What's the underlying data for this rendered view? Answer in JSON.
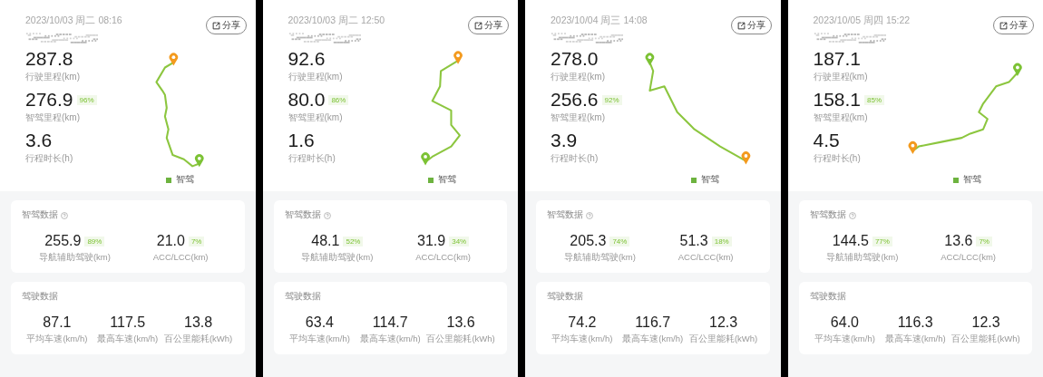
{
  "trips": [
    {
      "date": "2023/10/03 周二 08:16",
      "share": "分享",
      "stats": [
        {
          "value": "287.8",
          "label": "行驶里程(km)"
        },
        {
          "value": "276.9",
          "badge": "96%",
          "label": "智驾里程(km)"
        },
        {
          "value": "3.6",
          "label": "行程时长(h)"
        }
      ],
      "legend": "智驾",
      "smart_card": {
        "title": "智驾数据",
        "items": [
          {
            "value": "255.9",
            "badge": "89%",
            "label": "导航辅助驾驶(km)"
          },
          {
            "value": "21.0",
            "badge": "7%",
            "label": "ACC/LCC(km)"
          }
        ]
      },
      "drive_card": {
        "title": "驾驶数据",
        "items": [
          {
            "value": "87.1",
            "label": "平均车速(km/h)"
          },
          {
            "value": "117.5",
            "label": "最高车速(km/h)"
          },
          {
            "value": "13.8",
            "label": "百公里能耗(kWh)"
          }
        ]
      }
    },
    {
      "date": "2023/10/03 周二 12:50",
      "share": "分享",
      "stats": [
        {
          "value": "92.6",
          "label": "行驶里程(km)"
        },
        {
          "value": "80.0",
          "badge": "86%",
          "label": "智驾里程(km)"
        },
        {
          "value": "1.6",
          "label": "行程时长(h)"
        }
      ],
      "legend": "智驾",
      "smart_card": {
        "title": "智驾数据",
        "items": [
          {
            "value": "48.1",
            "badge": "52%",
            "label": "导航辅助驾驶(km)"
          },
          {
            "value": "31.9",
            "badge": "34%",
            "label": "ACC/LCC(km)"
          }
        ]
      },
      "drive_card": {
        "title": "驾驶数据",
        "items": [
          {
            "value": "63.4",
            "label": "平均车速(km/h)"
          },
          {
            "value": "114.7",
            "label": "最高车速(km/h)"
          },
          {
            "value": "13.6",
            "label": "百公里能耗(kWh)"
          }
        ]
      }
    },
    {
      "date": "2023/10/04 周三 14:08",
      "share": "分享",
      "stats": [
        {
          "value": "278.0",
          "label": "行驶里程(km)"
        },
        {
          "value": "256.6",
          "badge": "92%",
          "label": "智驾里程(km)"
        },
        {
          "value": "3.9",
          "label": "行程时长(h)"
        }
      ],
      "legend": "智驾",
      "smart_card": {
        "title": "智驾数据",
        "items": [
          {
            "value": "205.3",
            "badge": "74%",
            "label": "导航辅助驾驶(km)"
          },
          {
            "value": "51.3",
            "badge": "18%",
            "label": "ACC/LCC(km)"
          }
        ]
      },
      "drive_card": {
        "title": "驾驶数据",
        "items": [
          {
            "value": "74.2",
            "label": "平均车速(km/h)"
          },
          {
            "value": "116.7",
            "label": "最高车速(km/h)"
          },
          {
            "value": "12.3",
            "label": "百公里能耗(kWh)"
          }
        ]
      }
    },
    {
      "date": "2023/10/05 周四 15:22",
      "share": "分享",
      "stats": [
        {
          "value": "187.1",
          "label": "行驶里程(km)"
        },
        {
          "value": "158.1",
          "badge": "85%",
          "label": "智驾里程(km)"
        },
        {
          "value": "4.5",
          "label": "行程时长(h)"
        }
      ],
      "legend": "智驾",
      "smart_card": {
        "title": "智驾数据",
        "items": [
          {
            "value": "144.5",
            "badge": "77%",
            "label": "导航辅助驾驶(km)"
          },
          {
            "value": "13.6",
            "badge": "7%",
            "label": "ACC/LCC(km)"
          }
        ]
      },
      "drive_card": {
        "title": "驾驶数据",
        "items": [
          {
            "value": "64.0",
            "label": "平均车速(km/h)"
          },
          {
            "value": "116.3",
            "label": "最高车速(km/h)"
          },
          {
            "value": "12.3",
            "label": "百公里能耗(kWh)"
          }
        ]
      }
    }
  ]
}
